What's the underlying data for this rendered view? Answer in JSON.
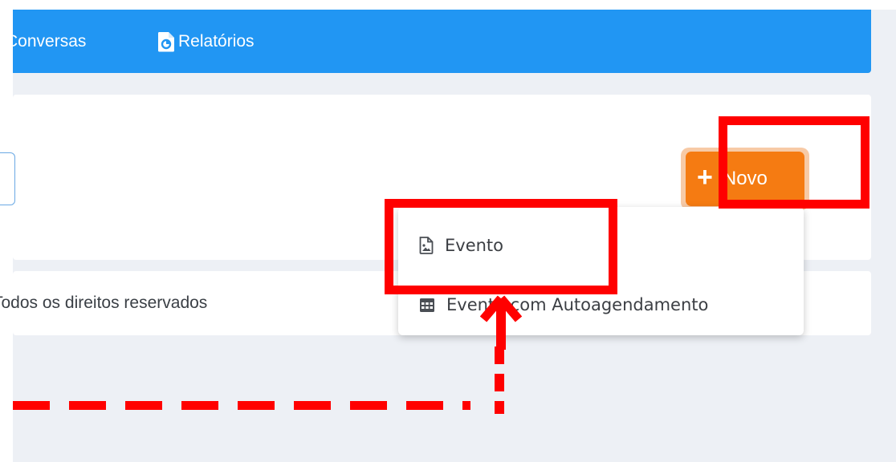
{
  "nav": {
    "conversas_label": "Conversas",
    "relatorios_label": "Relatórios"
  },
  "toolbar": {
    "novo_label": "Novo",
    "novo_icon": "plus-icon"
  },
  "dropdown": {
    "items": [
      {
        "label": "Evento",
        "icon": "image-file-icon"
      },
      {
        "label": "Evento com Autoagendamento",
        "icon": "calendar-grid-icon"
      }
    ]
  },
  "footer": {
    "text": "Todos os direitos reservados"
  },
  "colors": {
    "nav_bg": "#2196f3",
    "accent_orange": "#f57b12",
    "annotation_red": "#ff0000",
    "page_bg": "#edf0f5"
  }
}
